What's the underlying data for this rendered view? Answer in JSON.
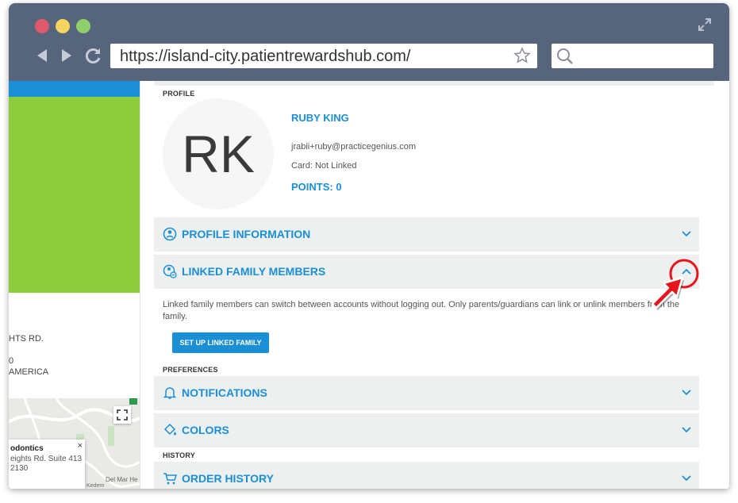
{
  "browser": {
    "url": "https://island-city.patientrewardshub.com/"
  },
  "sidebar": {
    "address_line1": "HTS RD.",
    "address_line2": "0",
    "address_line3": "AMERICA",
    "map_card": {
      "title": "odontics",
      "line1": "eights Rd. Suite 413",
      "line2": "2130",
      "close": "×"
    },
    "map_street1": "Del Mar He",
    "map_street2": "Kedern"
  },
  "profile": {
    "section_label": "PROFILE",
    "initials": "RK",
    "name": "RUBY KING",
    "email": "jrabii+ruby@practicegenius.com",
    "card": "Card: Not Linked",
    "points": "POINTS: 0"
  },
  "accordions": {
    "profile_information": "PROFILE INFORMATION",
    "linked_family": "LINKED FAMILY MEMBERS",
    "linked_family_description": "Linked family members can switch between accounts without logging out. Only parents/guardians can link or unlink members from the family.",
    "setup_button": "SET UP LINKED FAMILY"
  },
  "preferences": {
    "section_label": "PREFERENCES",
    "notifications": "NOTIFICATIONS",
    "colors": "COLORS"
  },
  "history": {
    "section_label": "HISTORY",
    "order_history": "ORDER HISTORY"
  },
  "colors": {
    "accent": "#1a8fd6",
    "green": "#8dcc3c",
    "chrome": "#56647c",
    "highlight": "#e8141b"
  }
}
